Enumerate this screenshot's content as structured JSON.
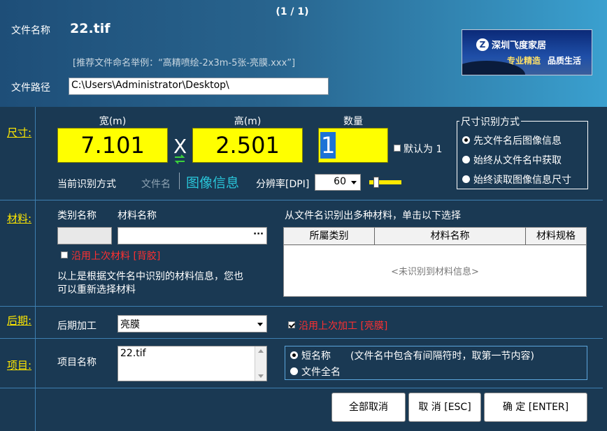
{
  "header": {
    "page_counter": "(1 / 1)",
    "file_name_label": "文件名称",
    "file_name": "22.tif",
    "naming_hint": "[推荐文件命名举例：“高精喷绘-2x3m-5张-亮膜.xxx”]",
    "file_path_label": "文件路径",
    "file_path": "C:\\Users\\Administrator\\Desktop\\",
    "ad": {
      "logo_letter": "Z",
      "company": "深圳飞度家居",
      "slogan_1": "专业精造",
      "slogan_2": "品质生活"
    }
  },
  "size": {
    "section_label": "尺寸:",
    "width_title": "宽(m)",
    "width_value": "7.101",
    "times_symbol": "X",
    "height_title": "高(m)",
    "height_value": "2.501",
    "qty_title": "数量",
    "qty_value": "1",
    "default_one_label": "默认为 1",
    "current_mode_label": "当前识别方式",
    "mode_filename": "文件名",
    "mode_image_info": "图像信息",
    "dpi_label": "分辨率[DPI]",
    "dpi_value": "60",
    "recog_group_title": "尺寸识别方式",
    "recog_options": [
      "先文件名后图像信息",
      "始终从文件名中获取",
      "始终读取图像信息尺寸"
    ]
  },
  "material": {
    "section_label": "材料:",
    "category_label": "类别名称",
    "name_label": "材料名称",
    "browse_label": "···",
    "reuse_label": "沿用上次材料 [背胶]",
    "info_line_1": "以上是根据文件名中识别的材料信息，您也",
    "info_line_2": "可以重新选择材料",
    "multi_hint": "从文件名识别出多种材料，单击以下选择",
    "table_headers": [
      "所屬类别",
      "材料名称",
      "材料规格"
    ],
    "table_empty": "<未识别到材料信息>"
  },
  "post": {
    "section_label": "后期:",
    "label": "后期加工",
    "value": "亮膜",
    "reuse_label": "沿用上次加工 [亮膜]"
  },
  "project": {
    "section_label": "项目:",
    "label": "项目名称",
    "value": "22.tif",
    "short_name_label": "短名称",
    "short_name_desc": "(文件名中包含有间隔符时，取第一节内容)",
    "full_name_label": "文件全名"
  },
  "buttons": {
    "cancel_all": "全部取消",
    "cancel": "取 消  [ESC]",
    "ok": "确  定  [ENTER]"
  },
  "colors": {
    "highlight_yellow": "#ffff00",
    "section_label": "#ffe800",
    "mode_active": "#29c4d8",
    "warning_red": "#ff3030"
  }
}
